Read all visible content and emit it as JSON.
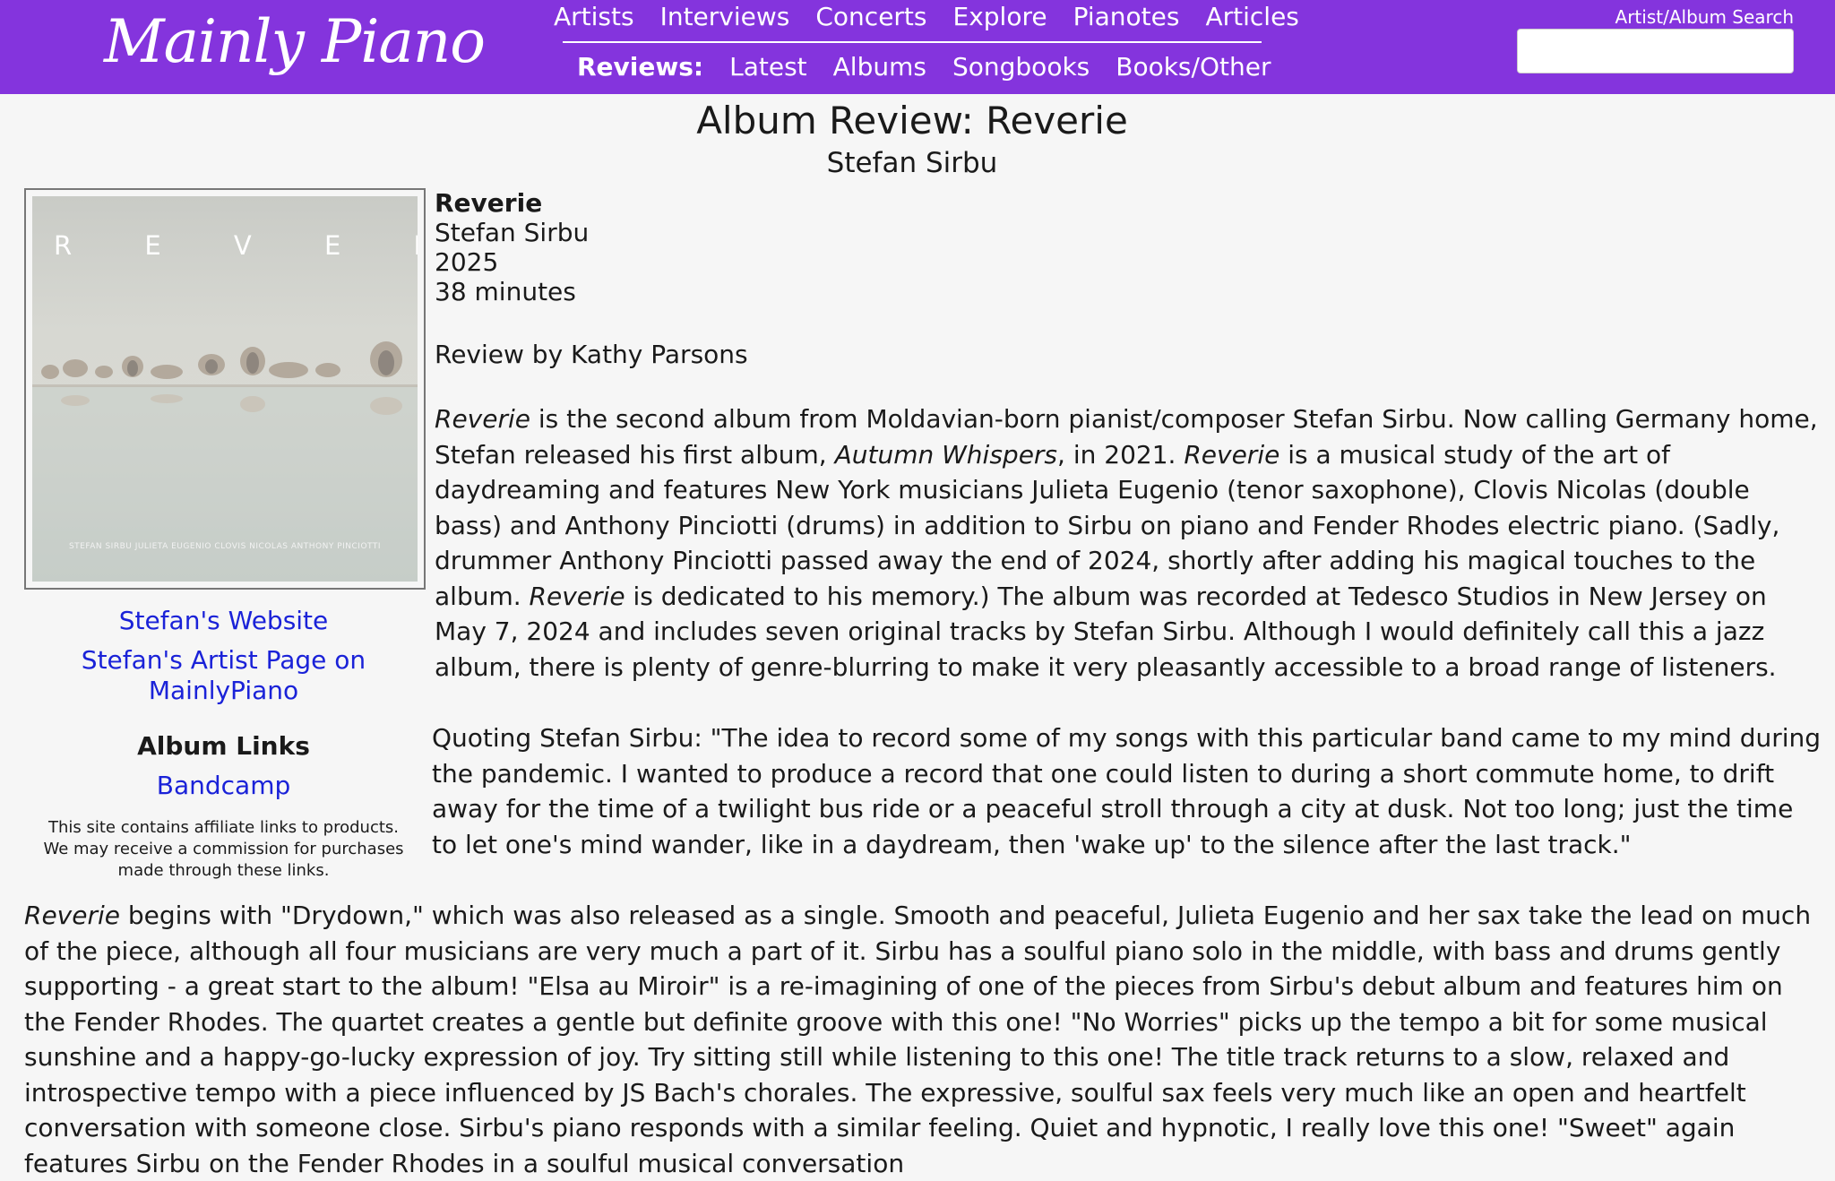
{
  "header": {
    "logo": "Mainly Piano",
    "nav_top": [
      "Artists",
      "Interviews",
      "Concerts",
      "Explore",
      "Pianotes",
      "Articles"
    ],
    "reviews_label": "Reviews:",
    "nav_bottom": [
      "Latest",
      "Albums",
      "Songbooks",
      "Books/Other"
    ],
    "search_label": "Artist/Album Search",
    "search_value": ""
  },
  "page": {
    "title": "Album Review: Reverie",
    "artist": "Stefan Sirbu"
  },
  "album_cover": {
    "title_text": "R E V E R I E",
    "credits_text": "STEFAN SIRBU   JULIETA EUGENIO   CLOVIS NICOLAS   ANTHONY PINCIOTTI"
  },
  "sidebar": {
    "website_link": "Stefan's Website",
    "artist_page_link": "Stefan's Artist Page on MainlyPiano",
    "album_links_heading": "Album Links",
    "bandcamp_link": "Bandcamp",
    "disclaimer": "This site contains affiliate links to products. We may receive a commission for purchases made through these links."
  },
  "album_info": {
    "name": "Reverie",
    "artist": "Stefan Sirbu",
    "year": "2025",
    "length": "38 minutes",
    "reviewer": "Review by Kathy Parsons"
  },
  "review": {
    "p1": [
      {
        "t": "Reverie",
        "i": true
      },
      {
        "t": " is the second album from Moldavian-born pianist/composer Stefan Sirbu. Now calling Germany home, Stefan released his first album, "
      },
      {
        "t": "Autumn Whispers",
        "i": true
      },
      {
        "t": ", in 2021. "
      },
      {
        "t": "Reverie",
        "i": true
      },
      {
        "t": " is a musical study of the art of daydreaming and features New York musicians Julieta Eugenio (tenor saxophone), Clovis Nicolas (double bass) and Anthony Pinciotti (drums) in addition to Sirbu on piano and Fender Rhodes electric piano. (Sadly, drummer Anthony Pinciotti passed away the end of 2024, shortly after adding his magical touches to the album. "
      },
      {
        "t": "Reverie",
        "i": true
      },
      {
        "t": " is dedicated to his memory.) The album was recorded at Tedesco Studios in New Jersey on May 7, 2024 and includes seven original tracks by Stefan Sirbu. Although I would definitely call this a jazz album, there is plenty of genre-blurring to make it very pleasantly accessible to a broad range of listeners."
      }
    ],
    "p2": [
      {
        "t": "Quoting Stefan Sirbu: \"The idea to record some of my songs with this particular band came to my mind during the pandemic. I wanted to produce a record that one could listen to during a short commute home, to drift away for the time of a twilight bus ride or a peaceful stroll through a city at dusk. Not too long; just the time to let one's mind wander, like in a daydream, then 'wake up' to the silence after the last track.\""
      }
    ],
    "p3": [
      {
        "t": "Reverie",
        "i": true
      },
      {
        "t": " begins with \"Drydown,\" which was also released as a single. Smooth and peaceful, Julieta Eugenio and her sax take the lead on much of the piece, although all four musicians are very much a part of it. Sirbu has a soulful piano solo in the middle, with bass and drums gently supporting - a great start to the album! \"Elsa au Miroir\" is a re-imagining of one of the pieces from Sirbu's debut album and features him on the Fender Rhodes. The quartet creates a gentle but definite groove with this one! \"No Worries\" picks up the tempo a bit for some musical sunshine and a happy-go-lucky expression of joy. Try sitting still while listening to this one! The title track returns to a slow, relaxed and introspective tempo with a piece influenced by JS Bach's chorales. The expressive, soulful sax feels very much like an open and heartfelt conversation with someone close. Sirbu's piano responds with a similar feeling. Quiet and hypnotic, I really love this one! \"Sweet\" again features Sirbu on the Fender Rhodes in a soulful musical conversation"
      }
    ]
  }
}
